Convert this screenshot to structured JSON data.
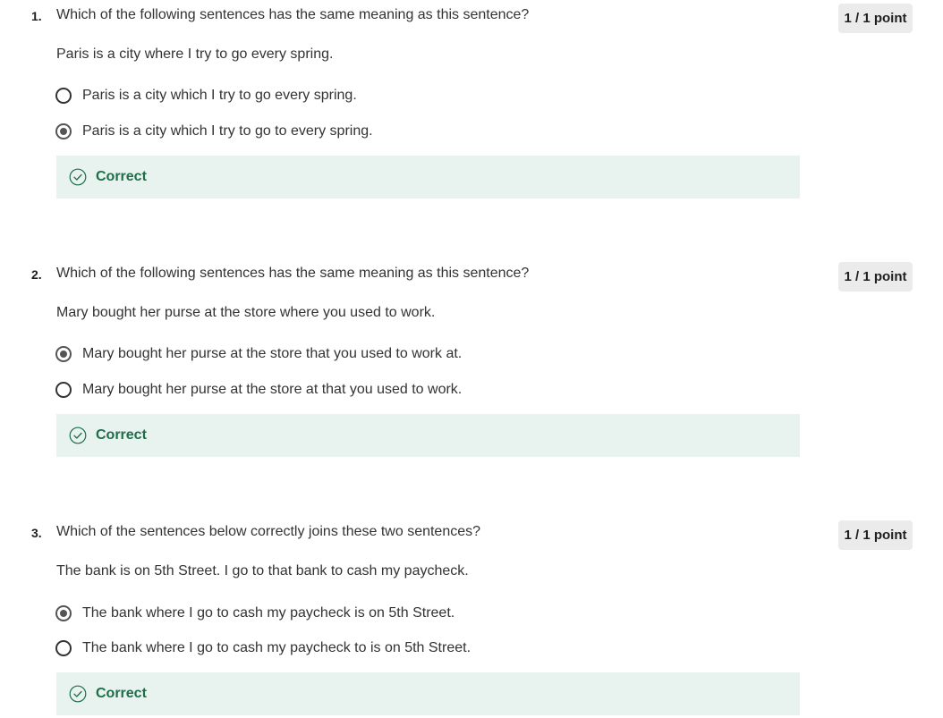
{
  "questions": [
    {
      "number": "1.",
      "prompt": "Which of the following sentences has the same meaning as this sentence?",
      "sentence": "Paris is a city where I try to go every spring.",
      "score": "1 / 1 point",
      "options": [
        {
          "label": "Paris is a city which I try to go every spring.",
          "selected": false
        },
        {
          "label": "Paris is a city which I try to go to every spring.",
          "selected": true
        }
      ],
      "feedback": "Correct"
    },
    {
      "number": "2.",
      "prompt": "Which of the following sentences has the same meaning as this sentence?",
      "sentence": "Mary bought her purse at the store where you used to work.",
      "score": "1 / 1 point",
      "options": [
        {
          "label": "Mary bought her purse at the store that you used to work at.",
          "selected": true
        },
        {
          "label": "Mary bought her purse at the store at that you used to work.",
          "selected": false
        }
      ],
      "feedback": "Correct"
    },
    {
      "number": "3.",
      "prompt": "Which of the sentences below correctly joins these two sentences?",
      "sentence": "The bank is on 5th Street. I go to that bank to cash my paycheck.",
      "score": "1 / 1 point",
      "options": [
        {
          "label": "The bank where I go to cash my paycheck is on 5th Street.",
          "selected": true
        },
        {
          "label": "The bank where I go to cash my paycheck to is on 5th Street.",
          "selected": false
        }
      ],
      "feedback": "Correct"
    }
  ],
  "colors": {
    "feedback_bg": "#e8f2ef",
    "correct_green": "#1f6e4a",
    "badge_bg": "#ebebeb"
  },
  "icons": {
    "correct": "check-circle-icon",
    "radio_selected": "radio-selected-icon",
    "radio_unselected": "radio-unselected-icon"
  }
}
